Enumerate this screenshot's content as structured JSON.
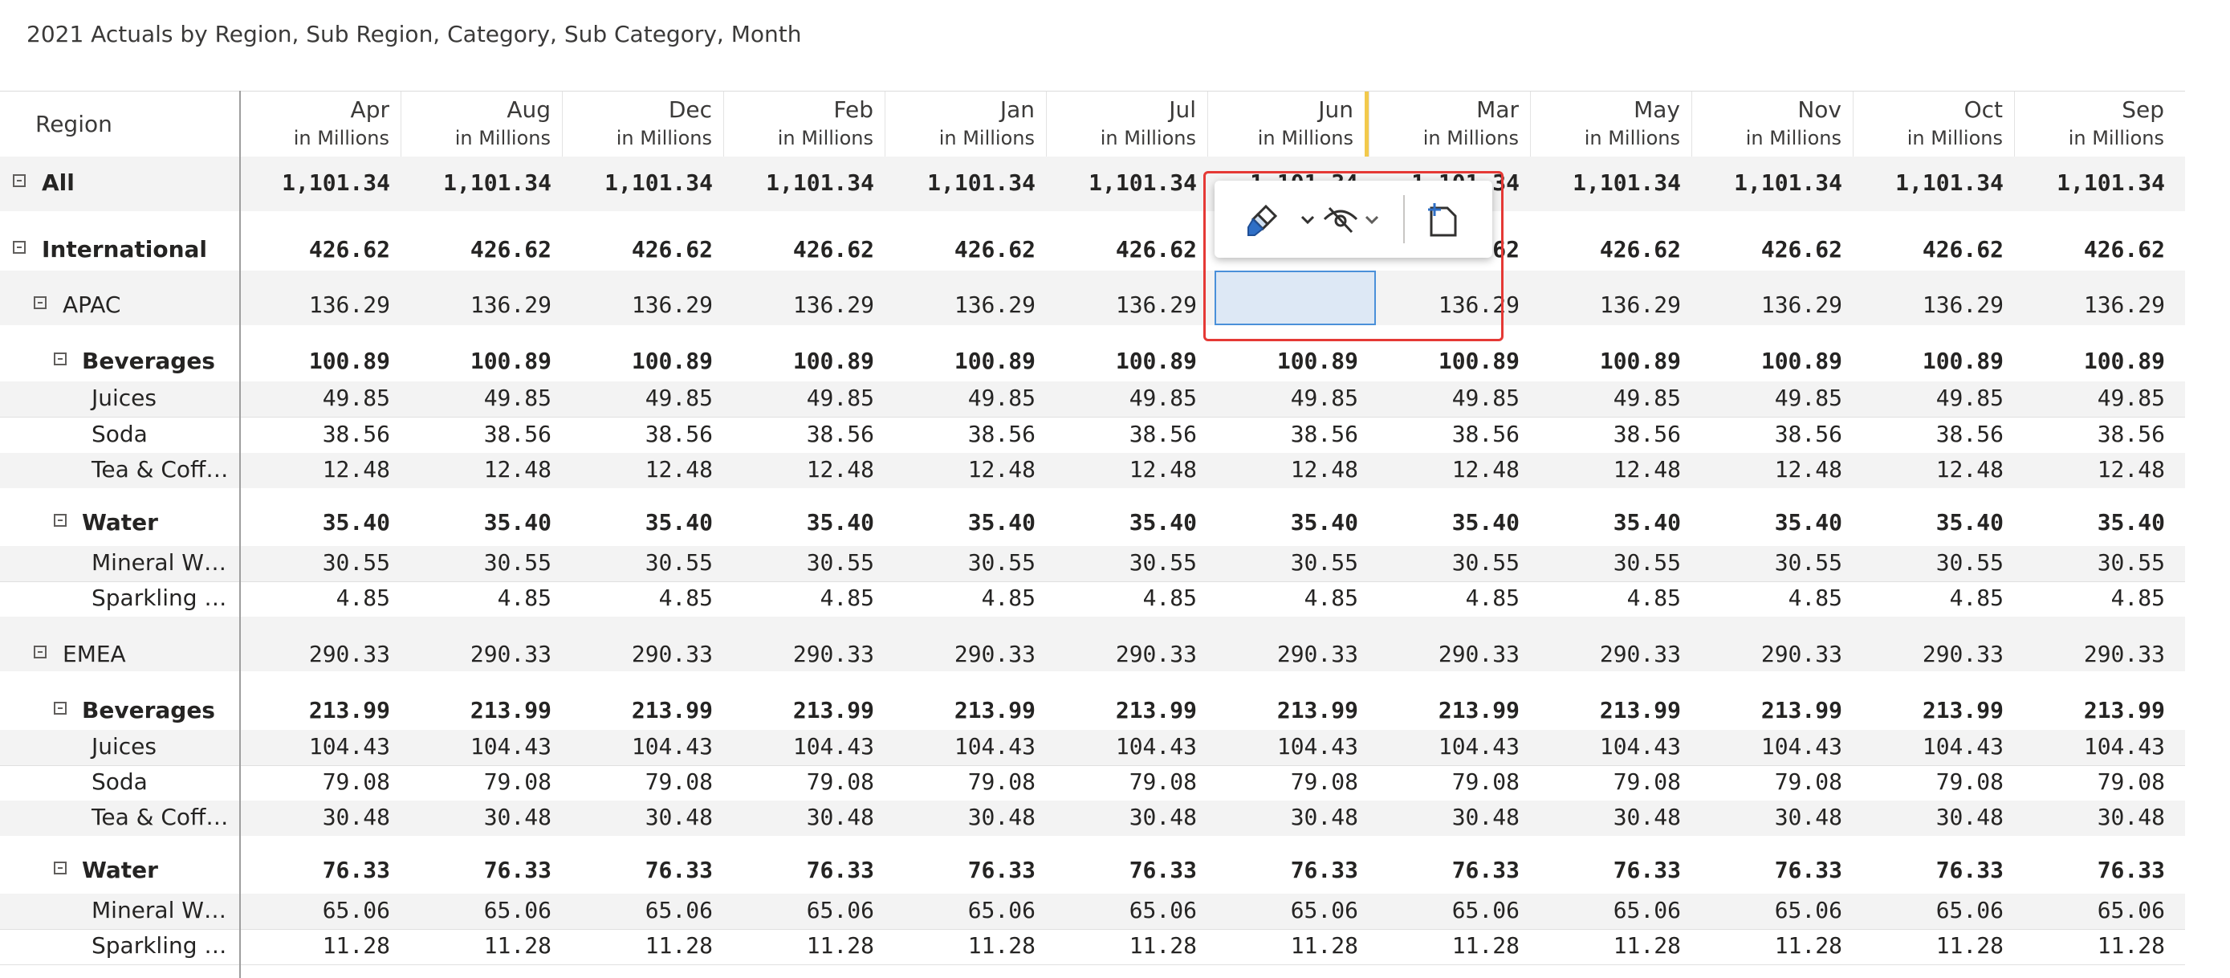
{
  "title": "2021 Actuals by Region, Sub Region, Category, Sub Category, Month",
  "header": {
    "region_label": "Region",
    "unit": "in Millions",
    "months": [
      "Apr",
      "Aug",
      "Dec",
      "Feb",
      "Jan",
      "Jul",
      "Jun",
      "Mar",
      "May",
      "Nov",
      "Oct",
      "Sep"
    ]
  },
  "rows": [
    {
      "label": "All",
      "value": "1,101.34"
    },
    {
      "label": "International",
      "value": "426.62"
    },
    {
      "label": "APAC",
      "value": "136.29"
    },
    {
      "label": "Beverages",
      "value": "100.89"
    },
    {
      "label": "Juices",
      "value": "49.85"
    },
    {
      "label": "Soda",
      "value": "38.56"
    },
    {
      "label": "Tea & Coff…",
      "value": "12.48"
    },
    {
      "label": "Water",
      "value": "35.40"
    },
    {
      "label": "Mineral W…",
      "value": "30.55"
    },
    {
      "label": "Sparkling …",
      "value": "4.85"
    },
    {
      "label": "EMEA",
      "value": "290.33"
    },
    {
      "label": "Beverages",
      "value": "213.99"
    },
    {
      "label": "Juices",
      "value": "104.43"
    },
    {
      "label": "Soda",
      "value": "79.08"
    },
    {
      "label": "Tea & Coff…",
      "value": "30.48"
    },
    {
      "label": "Water",
      "value": "76.33"
    },
    {
      "label": "Mineral W…",
      "value": "65.06"
    },
    {
      "label": "Sparkling …",
      "value": "11.28"
    }
  ],
  "popup": {
    "format_icon": "paintbrush-icon",
    "hide_icon": "eye-hidden-icon",
    "insert_icon": "insert-row-icon"
  },
  "colors": {
    "selection_fill": "#dde8f5",
    "selection_border": "#4a90d9",
    "highlight_outline": "#e53935",
    "column_marker": "#f2c94c"
  }
}
